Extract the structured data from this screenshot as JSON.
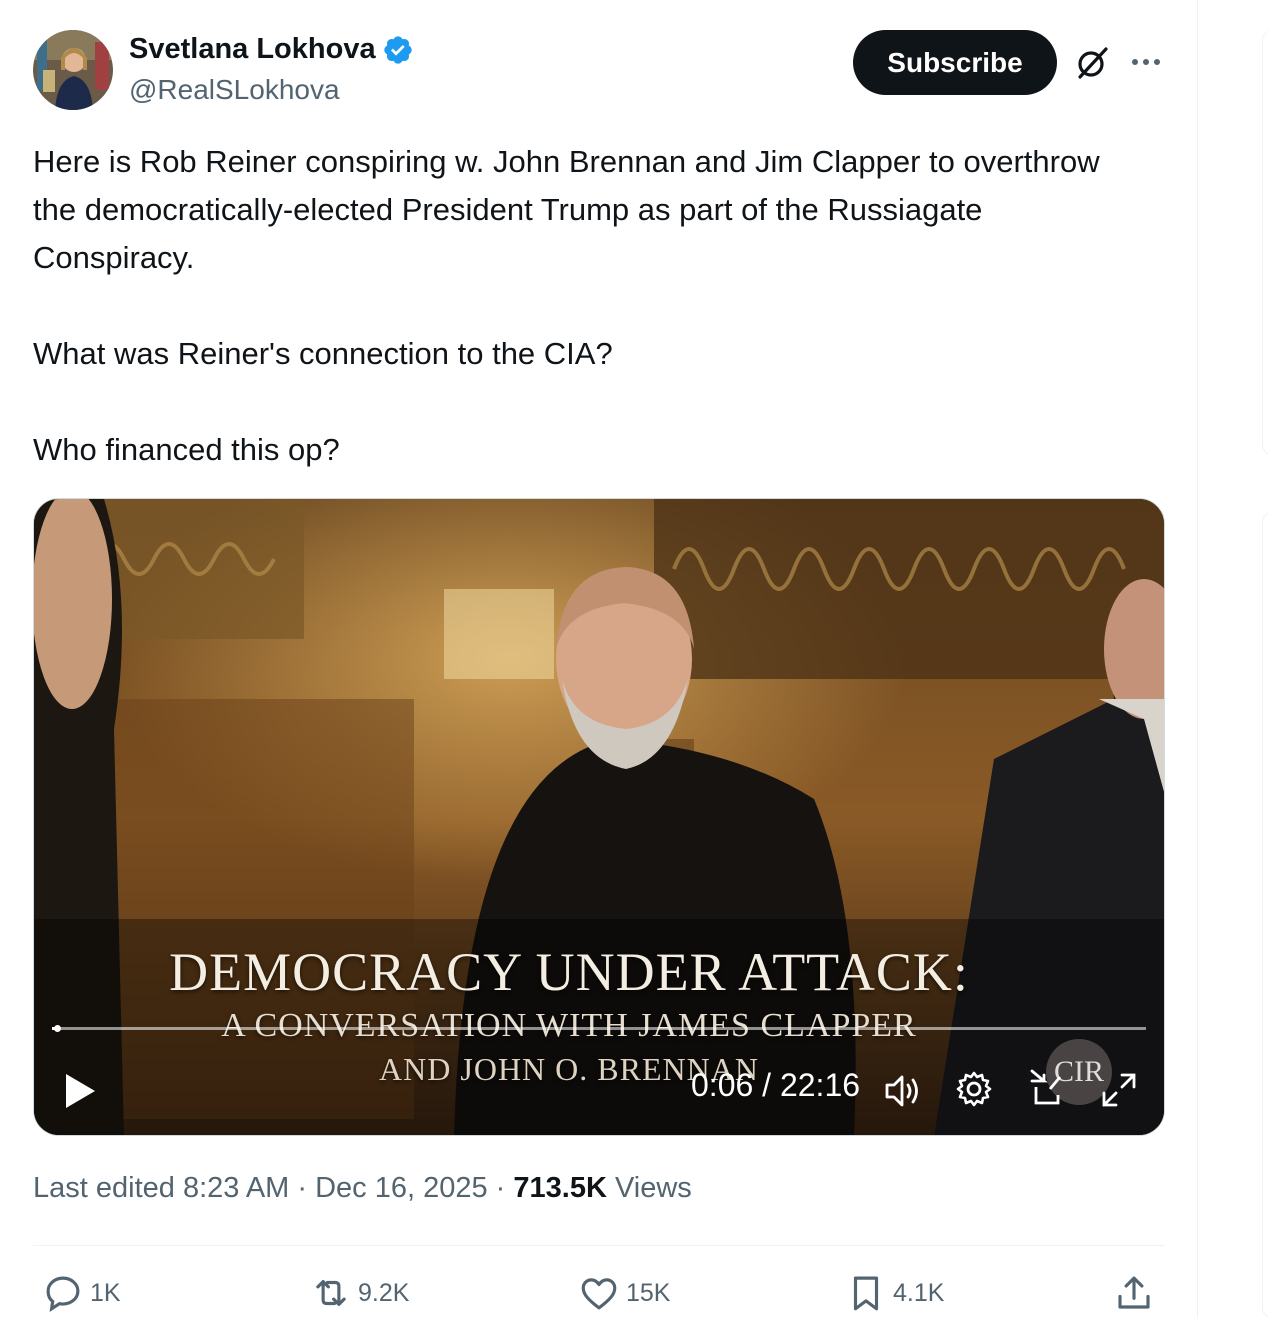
{
  "author": {
    "name": "Svetlana Lokhova",
    "handle": "@RealSLokhova",
    "verified": true,
    "verified_color": "#1d9bf0"
  },
  "header": {
    "subscribe_label": "Subscribe"
  },
  "tweet": {
    "paragraphs": [
      "Here is Rob Reiner conspiring w. John Brennan and Jim Clapper to overthrow the democratically-elected President Trump as part of the Russiagate Conspiracy.",
      "What was Reiner's connection to the CIA?",
      "Who financed this op?"
    ]
  },
  "video": {
    "title_line1": "DEMOCRACY UNDER ATTACK:",
    "title_line2": "A CONVERSATION WITH JAMES CLAPPER",
    "title_line3": "AND JOHN O. BRENNAN",
    "logo_text": "CIR",
    "time_display": "0:06 / 22:16",
    "progress_fraction": 0.0045
  },
  "meta": {
    "edited": "Last edited 8:23 AM · Dec 16, 2025 · ",
    "views_count": "713.5K",
    "views_label": " Views"
  },
  "actions": {
    "replies": "1K",
    "reposts": "9.2K",
    "likes": "15K",
    "bookmarks": "4.1K"
  },
  "icons": [
    "verified-badge-icon",
    "grok-icon",
    "more-icon",
    "play-icon",
    "volume-icon",
    "settings-gear-icon",
    "pip-icon",
    "fullscreen-icon",
    "reply-icon",
    "repost-icon",
    "like-icon",
    "bookmark-icon",
    "share-icon"
  ]
}
